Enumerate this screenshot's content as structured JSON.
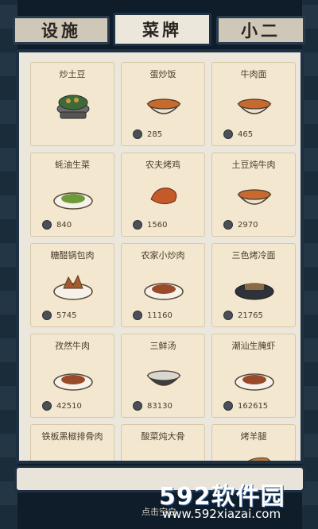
{
  "tabs": [
    {
      "label": "设施",
      "active": false
    },
    {
      "label": "菜牌",
      "active": true
    },
    {
      "label": "小二",
      "active": false
    }
  ],
  "menu": [
    {
      "name": "炒土豆",
      "price": "",
      "dish": "pot"
    },
    {
      "name": "蛋炒饭",
      "price": "285",
      "dish": "bowl"
    },
    {
      "name": "牛肉面",
      "price": "465",
      "dish": "bowl"
    },
    {
      "name": "蚝油生菜",
      "price": "840",
      "dish": "plate-green"
    },
    {
      "name": "农夫烤鸡",
      "price": "1560",
      "dish": "roast"
    },
    {
      "name": "土豆炖牛肉",
      "price": "2970",
      "dish": "bowl"
    },
    {
      "name": "糖醋锅包肉",
      "price": "5745",
      "dish": "plate-meat"
    },
    {
      "name": "农家小炒肉",
      "price": "11160",
      "dish": "plate-brown"
    },
    {
      "name": "三色烤冷面",
      "price": "21765",
      "dish": "plate-dark"
    },
    {
      "name": "孜然牛肉",
      "price": "42510",
      "dish": "plate-brown"
    },
    {
      "name": "三鲜汤",
      "price": "83130",
      "dish": "bowl-dark"
    },
    {
      "name": "潮汕生腌虾",
      "price": "162615",
      "dish": "plate-brown"
    },
    {
      "name": "铁板黑椒排骨肉",
      "price": "",
      "dish": "plate-brown"
    },
    {
      "name": "酸菜炖大骨",
      "price": "",
      "dish": "bowl"
    },
    {
      "name": "烤羊腿",
      "price": "",
      "dish": "leg"
    }
  ],
  "hint": "点击空白",
  "watermark": {
    "brand": "592软件园",
    "url": "www.592xiazai.com"
  },
  "colors": {
    "coin": "#4b5058",
    "frame": "#1e3144",
    "card": "#f3e8cf"
  }
}
